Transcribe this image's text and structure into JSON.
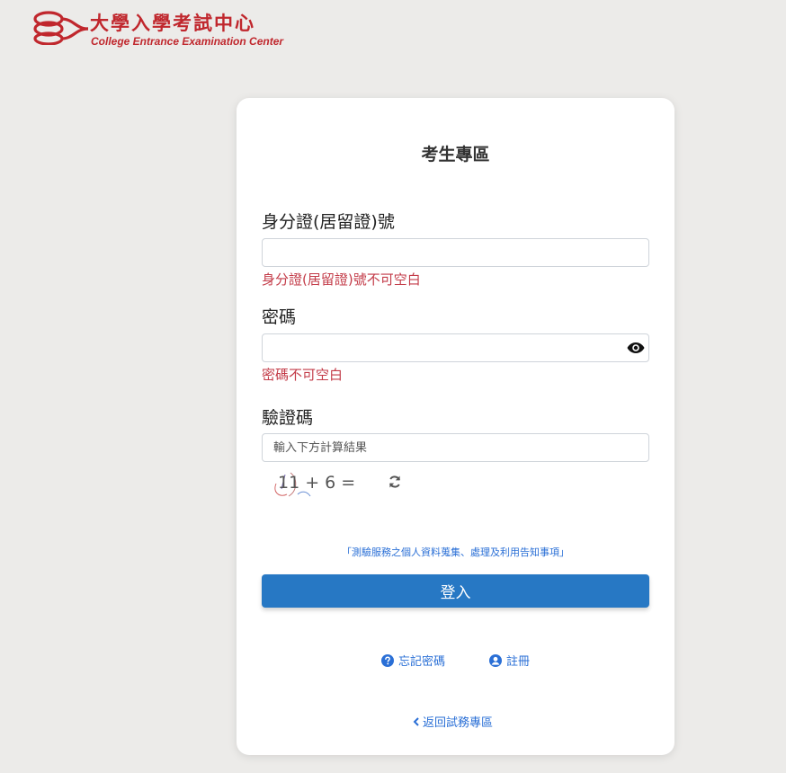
{
  "logo": {
    "name_zh": "大學入學考試中心",
    "name_en": "College Entrance Examination Center"
  },
  "card": {
    "title": "考生專區"
  },
  "id_field": {
    "label": "身分證(居留證)號",
    "value": "",
    "error": "身分證(居留證)號不可空白"
  },
  "password_field": {
    "label": "密碼",
    "value": "",
    "error": "密碼不可空白"
  },
  "captcha_field": {
    "label": "驗證碼",
    "placeholder": "輸入下方計算結果",
    "challenge": "11 + 6 ="
  },
  "notice_link": "「測驗服務之個人資料蒐集、處理及利用告知事項」",
  "login_button": "登入",
  "links": {
    "forgot_password": "忘記密碼",
    "register": "註冊",
    "back": "返回試務專區"
  },
  "colors": {
    "brand_red": "#c0272d",
    "primary_blue": "#2778c4",
    "link_blue": "#2a6fd6",
    "error_red": "#c33b48"
  },
  "icons": [
    "logo-mark-icon",
    "eye-icon",
    "refresh-icon",
    "question-circle-icon",
    "user-circle-icon",
    "chevron-left-icon"
  ]
}
